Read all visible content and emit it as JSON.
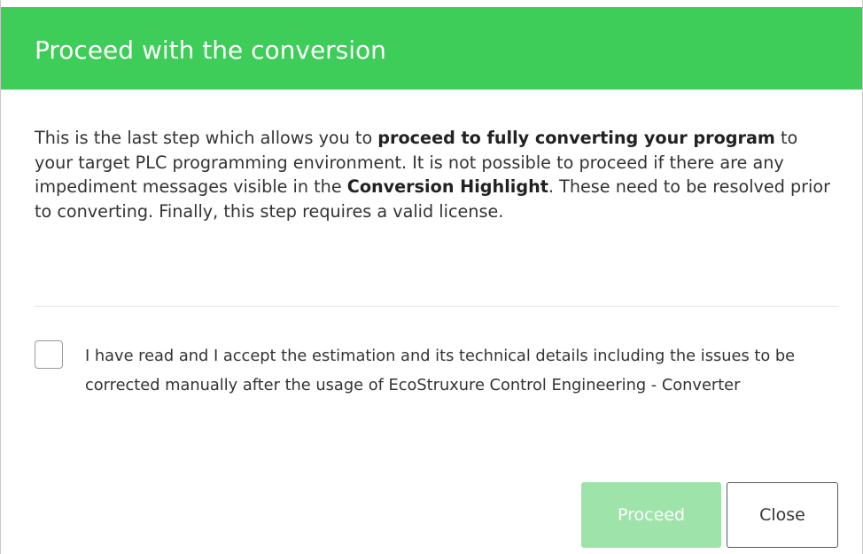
{
  "dialog": {
    "title": "Proceed with the conversion",
    "description": {
      "part1": "This is the last step which allows you to ",
      "bold1": "proceed to fully converting your program",
      "part2": " to your target PLC programming environment. It is not possible to proceed if there are any impediment messages visible in the ",
      "bold2": "Conversion Highlight",
      "part3": ". These need to be resolved prior to converting. Finally, this step requires a valid license."
    },
    "acceptance": {
      "checked": false,
      "label": "I have read and I accept the estimation and its technical details including the issues to be corrected manually after the usage of EcoStruxure Control Engineering - Converter"
    },
    "buttons": {
      "proceed_label": "Proceed",
      "proceed_disabled": true,
      "close_label": "Close"
    },
    "colors": {
      "header": "#3dcd58",
      "proceed_disabled": "#9ee3aa"
    }
  }
}
